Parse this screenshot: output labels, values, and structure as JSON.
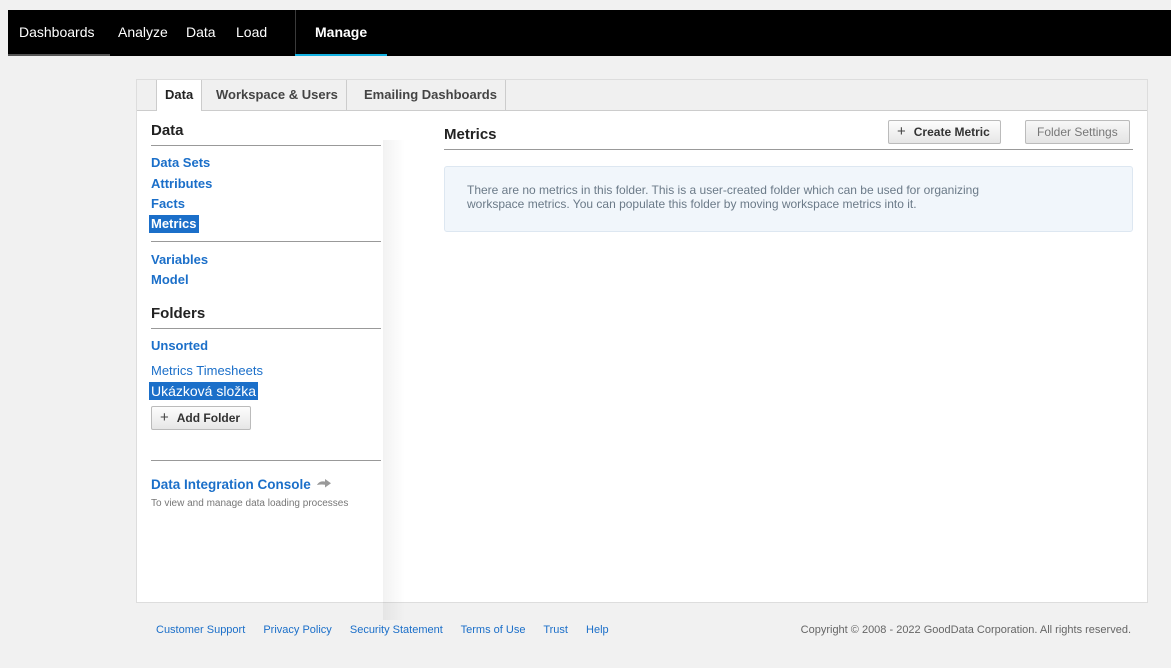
{
  "topnav": {
    "items": [
      "Dashboards",
      "Analyze",
      "Data",
      "Load"
    ],
    "active": "Manage"
  },
  "tabs": [
    "Data",
    "Workspace & Users",
    "Emailing Dashboards"
  ],
  "left": {
    "data_title": "Data",
    "data_links": [
      "Data Sets",
      "Attributes",
      "Facts",
      "Metrics"
    ],
    "other_links": [
      "Variables",
      "Model"
    ],
    "folders_title": "Folders",
    "unsorted": "Unsorted",
    "folders": [
      "Metrics Timesheets",
      "Ukázková složka"
    ],
    "add_folder": "Add Folder",
    "dic_title": "Data Integration Console",
    "dic_desc": "To view and manage data loading processes"
  },
  "main": {
    "title": "Metrics",
    "create_metric": "Create Metric",
    "folder_settings": "Folder Settings",
    "empty_line1": "There are no metrics in this folder. This is a user-created folder which can be used for organizing",
    "empty_line2": "workspace metrics. You can populate this folder by moving workspace metrics into it."
  },
  "footer": {
    "links": [
      "Customer Support",
      "Privacy Policy",
      "Security Statement",
      "Terms of Use",
      "Trust",
      "Help"
    ],
    "copyright": "Copyright © 2008 - 2022 GoodData Corporation. All rights reserved."
  },
  "colors": {
    "accent": "#14b2e2",
    "link": "#1b6fc9"
  }
}
